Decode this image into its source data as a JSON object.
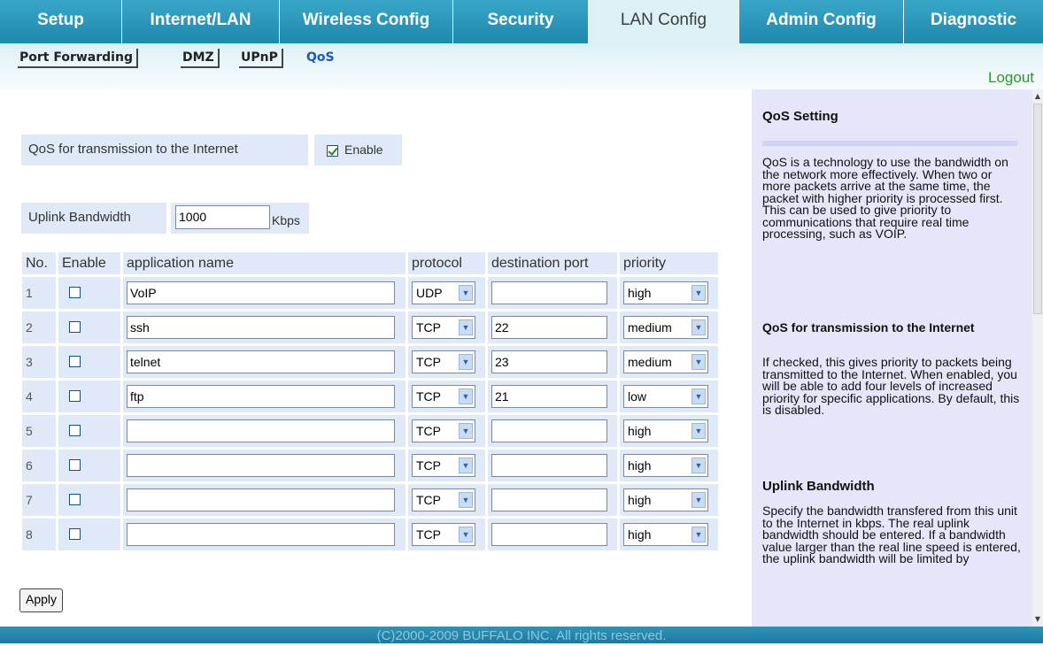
{
  "tabs": [
    {
      "label": "Setup"
    },
    {
      "label": "Internet/LAN"
    },
    {
      "label": "Wireless Config"
    },
    {
      "label": "Security"
    },
    {
      "label": "LAN Config",
      "active": true
    },
    {
      "label": "Admin Config"
    },
    {
      "label": "Diagnostic"
    }
  ],
  "subnav": [
    {
      "label": "Port Forwarding"
    },
    {
      "label": "DMZ"
    },
    {
      "label": "UPnP"
    },
    {
      "label": "QoS",
      "active": true
    }
  ],
  "logout": "Logout",
  "qos_internet": {
    "label": "QoS for transmission to the Internet",
    "enable_label": "Enable",
    "checked": true
  },
  "uplink": {
    "label": "Uplink Bandwidth",
    "value": "1000",
    "unit": "Kbps"
  },
  "table": {
    "headers": [
      "No.",
      "Enable",
      "application name",
      "protocol",
      "destination port",
      "priority"
    ],
    "rows": [
      {
        "no": "1",
        "enabled": false,
        "app": "VoIP",
        "protocol": "UDP",
        "port": "",
        "priority": "high"
      },
      {
        "no": "2",
        "enabled": false,
        "app": "ssh",
        "protocol": "TCP",
        "port": "22",
        "priority": "medium"
      },
      {
        "no": "3",
        "enabled": false,
        "app": "telnet",
        "protocol": "TCP",
        "port": "23",
        "priority": "medium"
      },
      {
        "no": "4",
        "enabled": false,
        "app": "ftp",
        "protocol": "TCP",
        "port": "21",
        "priority": "low"
      },
      {
        "no": "5",
        "enabled": false,
        "app": "",
        "protocol": "TCP",
        "port": "",
        "priority": "high"
      },
      {
        "no": "6",
        "enabled": false,
        "app": "",
        "protocol": "TCP",
        "port": "",
        "priority": "high"
      },
      {
        "no": "7",
        "enabled": false,
        "app": "",
        "protocol": "TCP",
        "port": "",
        "priority": "high"
      },
      {
        "no": "8",
        "enabled": false,
        "app": "",
        "protocol": "TCP",
        "port": "",
        "priority": "high"
      }
    ]
  },
  "apply_label": "Apply",
  "help": {
    "title": "QoS Setting",
    "intro": "QoS is a technology to use the bandwidth on the network more effectively. When two or more packets arrive at the same time, the packet with higher priority is processed first. This can be used to give priority to communications that require real time processing, such as VOIP.",
    "section1_title": "QoS for transmission to the Internet",
    "section1_text": "If checked, this gives priority to packets being transmitted to the Internet. When enabled, you will be able to add four levels of increased priority for specific applications. By default, this is disabled.",
    "section2_title": "Uplink Bandwidth",
    "section2_text": "Specify the bandwidth transfered from this unit to the Internet in kbps. The real uplink bandwidth should be entered. If a bandwidth value larger than the real line speed is entered, the uplink bandwidth will be limited by"
  },
  "footer": "(C)2000-2009 BUFFALO INC. All rights reserved."
}
